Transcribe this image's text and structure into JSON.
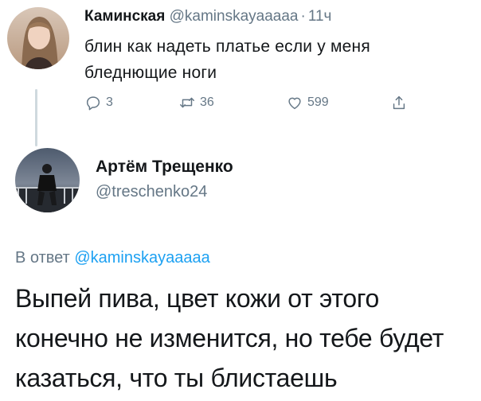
{
  "parent_tweet": {
    "display_name": "Каминская",
    "handle": "@kaminskayaaaaa",
    "separator": "·",
    "time": "11ч",
    "text": "блин как надеть платье если у меня бледнющие ноги",
    "actions": {
      "reply_count": "3",
      "retweet_count": "36",
      "like_count": "599",
      "reply_icon": "reply-icon",
      "retweet_icon": "retweet-icon",
      "like_icon": "heart-icon",
      "share_icon": "share-icon"
    }
  },
  "reply_tweet": {
    "display_name": "Артём Трещенко",
    "handle": "@treschenko24",
    "reply_prefix": "В ответ",
    "reply_to_handle": "@kaminskayaaaaa",
    "text": "Выпей пива, цвет кожи от этого конечно не изменится, но тебе будет казаться, что ты блистаешь"
  },
  "colors": {
    "text": "#14171a",
    "secondary": "#657786",
    "link": "#1da1f2",
    "thread_line": "#cfd9de"
  }
}
